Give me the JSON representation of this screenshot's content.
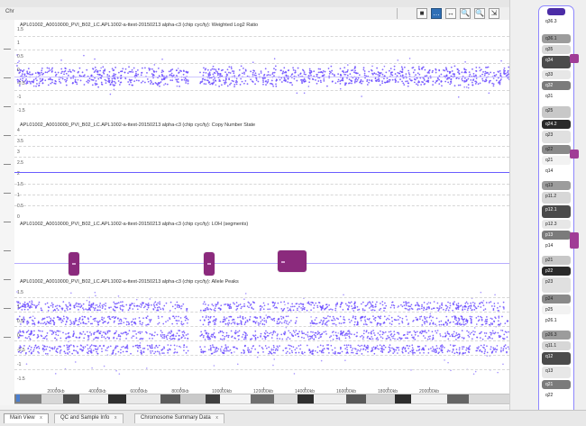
{
  "window": {
    "toolbar_title": "Chr",
    "buttons": {
      "btn1": "■",
      "btn2": "…",
      "btn3": "↔",
      "btn4": "🔍",
      "btn5": "🔍",
      "btn6": "⇲"
    }
  },
  "panels": [
    {
      "title": "APL01002_A0010000_PVI_B02_LC.APL1002-a-ttext-20150213 alpha-c3 (chip cyc/ty): Weighted Log2 Ratio",
      "ylabels": [
        "1.5",
        "1",
        "0.5",
        "0",
        "-0.5",
        "-1",
        "-1.5"
      ]
    },
    {
      "title": "APL01002_A0010000_PVI_B02_LC.APL1002-a-ttext-20150213 alpha-c3 (chip cyc/ty): Copy Number State",
      "ylabels": [
        "4",
        "3.5",
        "3",
        "2.5",
        "2",
        "1.5",
        "1",
        "0.5",
        "0"
      ]
    },
    {
      "title": "APL01002_A0010000_PVI_B02_LC.APL1002-a-ttext-20150213 alpha-c3 (chip cyc/ty): LOH (segments)",
      "ylabels": []
    },
    {
      "title": "APL01002_A0010000_PVI_B02_LC.APL1002-a-ttext-20150213 alpha-c3 (chip cyc/ty): Allele Peaks",
      "ylabels": [
        "1.5",
        "1",
        "0.5",
        "0",
        "-0.5",
        "-1",
        "-1.5"
      ]
    }
  ],
  "ruler": {
    "ticks": [
      "20000kb",
      "40000kb",
      "60000kb",
      "80000kb",
      "100000kb",
      "120000kb",
      "140000kb",
      "160000kb",
      "180000kb",
      "200000kb"
    ]
  },
  "ideogram": {
    "bands": [
      "q36.3",
      "q36.1",
      "q35",
      "q34",
      "q33",
      "q32",
      "q31",
      "q25",
      "q24.2",
      "q23",
      "q22",
      "q21",
      "q14",
      "q13",
      "p11.2",
      "p12.1",
      "p12.3",
      "p13",
      "p14",
      "p21",
      "p22",
      "p23",
      "p24",
      "p25",
      "p26.1",
      "p26.3",
      "q11.1",
      "q12",
      "q13",
      "q21",
      "q22",
      "q23",
      "q24",
      "q25",
      "q26",
      "p1"
    ]
  },
  "tabs": [
    {
      "label": "Main View"
    },
    {
      "label": "QC and Sample Info"
    },
    {
      "label": "Chromosome Summary Data"
    }
  ]
}
